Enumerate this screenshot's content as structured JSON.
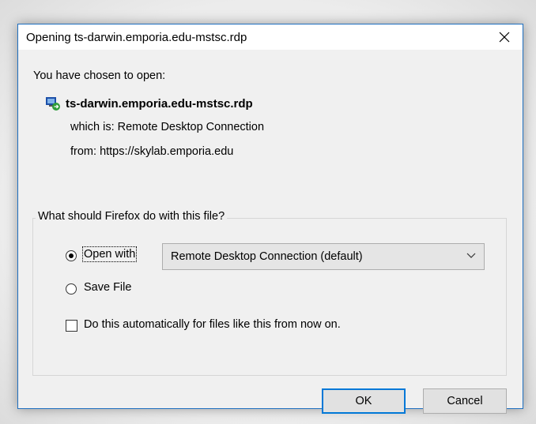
{
  "dialog": {
    "title": "Opening ts-darwin.emporia.edu-mstsc.rdp",
    "intro": "You have chosen to open:",
    "file_name": "ts-darwin.emporia.edu-mstsc.rdp",
    "which_is_label": "which is:",
    "which_is_value": "Remote Desktop Connection",
    "from_label": "from:",
    "from_value": "https://skylab.emporia.edu",
    "group_title": "What should Firefox do with this file?",
    "options": {
      "open_with_label": "Open with",
      "open_with_selected": true,
      "open_with_app": "Remote Desktop Connection (default)",
      "save_file_label": "Save File",
      "save_file_selected": false,
      "auto_label": "Do this automatically for files like this from now on.",
      "auto_checked": false
    },
    "buttons": {
      "ok": "OK",
      "cancel": "Cancel"
    },
    "accent_color": "#0078d7"
  }
}
